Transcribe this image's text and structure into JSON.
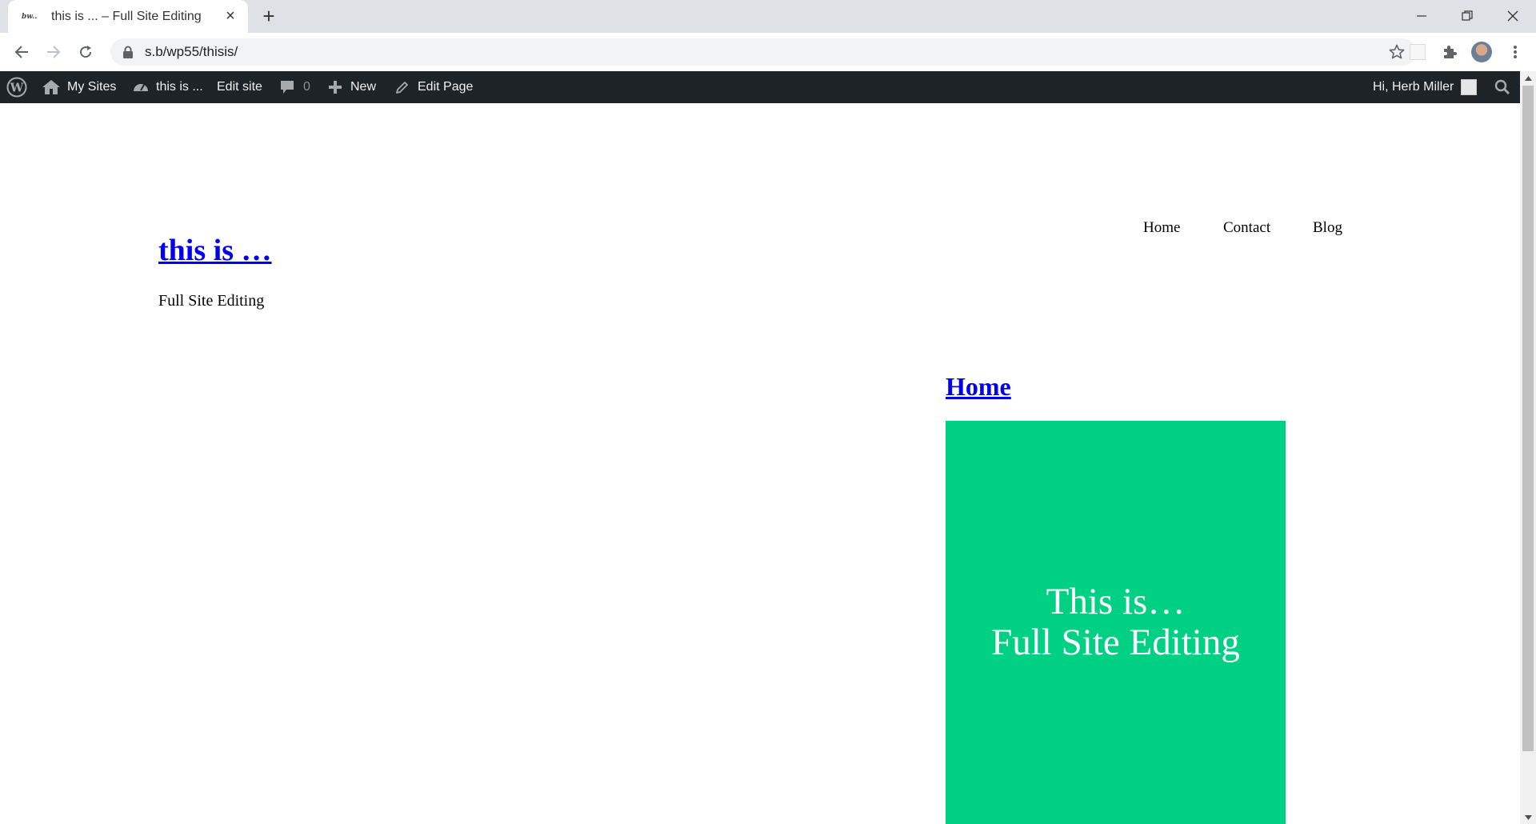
{
  "browser": {
    "tab": {
      "favicon_text": "bw..",
      "title": "this is ... – Full Site Editing"
    },
    "url": "s.b/wp55/thisis/"
  },
  "admin_bar": {
    "my_sites": "My Sites",
    "site_name": "this is ...",
    "edit_site": "Edit site",
    "comments_count": "0",
    "new": "New",
    "edit_page": "Edit Page",
    "greeting": "Hi, Herb Miller"
  },
  "site": {
    "title": "this is …",
    "tagline": "Full Site Editing",
    "menu": [
      "Home",
      "Contact",
      "Blog"
    ]
  },
  "page": {
    "title": "Home",
    "cover": {
      "line1": "This is…",
      "line2": "Full Site Editing",
      "color": "#00d084"
    }
  },
  "colors": {
    "admin_bar": "#1d2327",
    "link": "#0000ee"
  }
}
